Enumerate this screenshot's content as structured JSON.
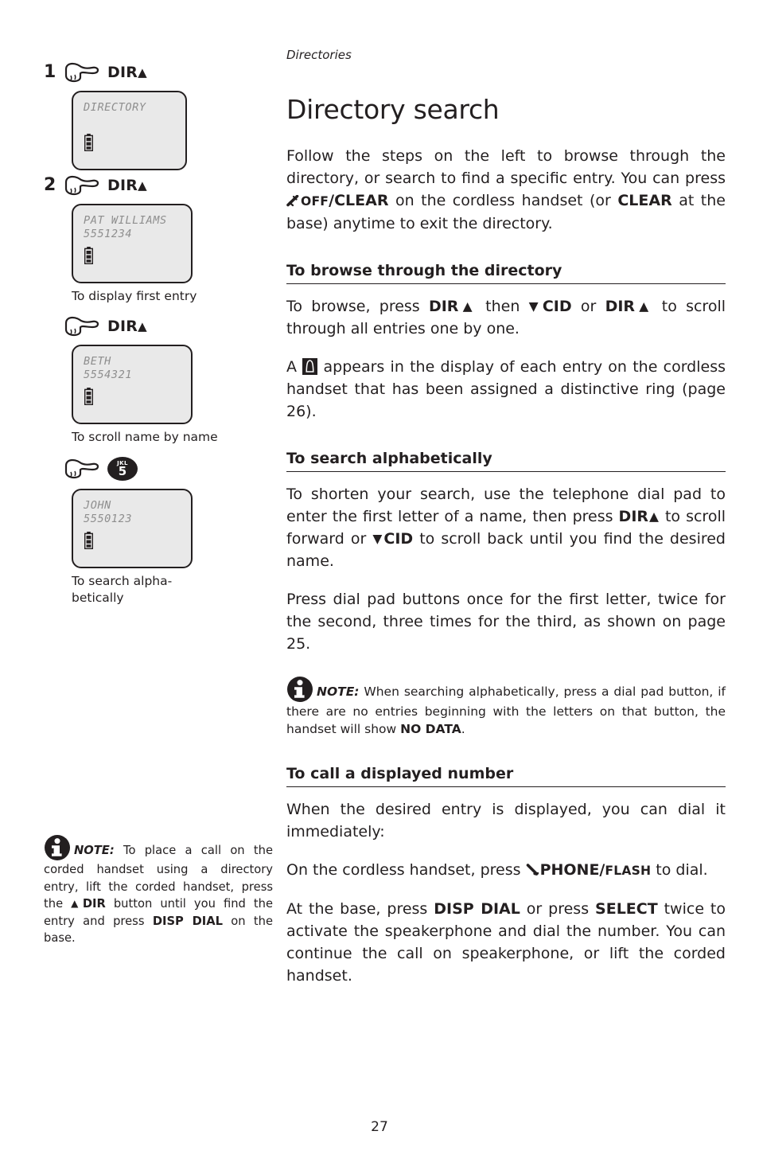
{
  "page": {
    "running_head": "Directories",
    "title": "Directory search",
    "number": "27"
  },
  "steps": [
    {
      "num": "1",
      "key_label": "DIR",
      "key_arrow": "▲",
      "icon": "pointing-hand-icon",
      "lcd": {
        "line1": "DIRECTORY",
        "line2": ""
      },
      "caption": ""
    },
    {
      "num": "2",
      "key_label": "DIR",
      "key_arrow": "▲",
      "icon": "pointing-hand-icon",
      "lcd": {
        "line1": "PAT WILLIAMS",
        "line2": "5551234"
      },
      "caption": "To display first entry"
    },
    {
      "num": "",
      "key_label": "DIR",
      "key_arrow": "▲",
      "icon": "pointing-hand-icon",
      "lcd": {
        "line1": "BETH",
        "line2": "5554321"
      },
      "caption": "To scroll name by name"
    },
    {
      "num": "",
      "key_label": "",
      "key_arrow": "",
      "icon": "pointing-hand-icon",
      "dial_key": {
        "letters": "JKL",
        "digit": "5"
      },
      "lcd": {
        "line1": "JOHN",
        "line2": "5550123"
      },
      "caption": "To search alpha-betically"
    }
  ],
  "left_note": {
    "icon": "info-icon",
    "label": "NOTE:",
    "text_1": " To place a call on the corded handset using a directory entry, lift the corded handset, press the ",
    "key_1": "DIR",
    "key_1_arrow": "▲",
    "text_2": " button until you find the entry and press ",
    "key_2": "DISP DIAL",
    "text_3": " on the base."
  },
  "intro": {
    "t1": "Follow the steps on the left to browse through the directory, or search to find a specific entry. You can press ",
    "key_off": "OFF",
    "key_clear": "/CLEAR",
    "t2": " on the cordless handset (or ",
    "key_clear2": "CLEAR",
    "t3": " at the base) anytime to exit the directory."
  },
  "sections": [
    {
      "heading": "To browse through the directory",
      "paragraphs": [
        {
          "t1": "To browse, press ",
          "k1": "DIR",
          "k1_arrow": "▲",
          "t2": " then ",
          "k2_arrow": "▼",
          "k2": "CID",
          "t3": " or ",
          "k3": "DIR",
          "k3_arrow": "▲",
          "t4": " to scroll through all entries one by one."
        },
        {
          "t1": "A ",
          "icon": "distinctive-ring-icon",
          "t2": " appears in the display of each entry on the cordless handset that has been assigned a distinctive ring (page 26)."
        }
      ]
    },
    {
      "heading": "To search alphabetically",
      "paragraphs": [
        {
          "t1": "To shorten your search, use the telephone dial pad to enter the first letter of a name, then press ",
          "k1": "DIR",
          "k1_arrow": "▲",
          "t2": " to scroll forward or ",
          "k2_arrow": "▼",
          "k2": "CID",
          "t3": " to scroll back until you find the desired name."
        },
        {
          "t1": "Press dial pad buttons once for the first letter, twice for the second, three times for the third, as shown on page 25."
        }
      ],
      "note": {
        "icon": "info-icon",
        "label": "NOTE:",
        "t1": " When searching alphabetically, press a dial pad button, if there are no entries beginning with the letters on that button, the handset will show ",
        "k1": "NO DATA",
        "t2": "."
      }
    },
    {
      "heading": "To call a displayed number",
      "paragraphs": [
        {
          "t1": "When the desired entry is displayed, you can dial it immediately:"
        },
        {
          "t1": "On the cordless handset, press ",
          "k_phone": "PHONE/",
          "k_flash": "FLASH",
          "t2": " to dial."
        },
        {
          "t1": "At the base, press ",
          "k1": "DISP DIAL",
          "t2": " or press ",
          "k2": "SELECT",
          "t3": " twice to activate the speakerphone and dial the number. You can continue the call on speakerphone, or lift the corded handset."
        }
      ]
    }
  ]
}
